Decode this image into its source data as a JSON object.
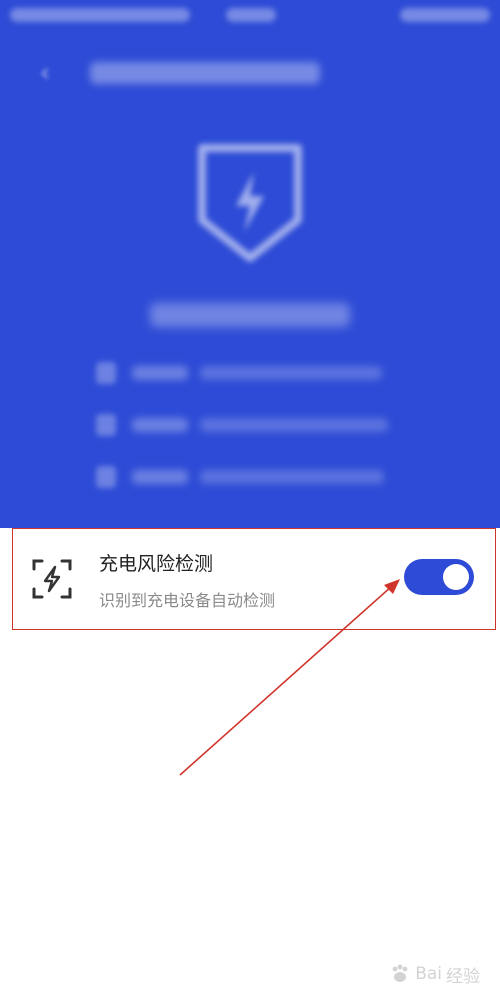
{
  "card": {
    "title": "充电风险检测",
    "subtitle": "识别到充电设备自动检测",
    "toggle_on": true
  },
  "watermark": {
    "brand": "Bai",
    "suffix": "经验"
  },
  "colors": {
    "hero_blue": "#2d4bd6",
    "highlight_red": "#d0352c",
    "toggle_blue": "#2d4bd6"
  },
  "icons": {
    "back": "back-arrow-icon",
    "shield": "shield-bolt-icon",
    "row": "bolt-scan-icon"
  }
}
